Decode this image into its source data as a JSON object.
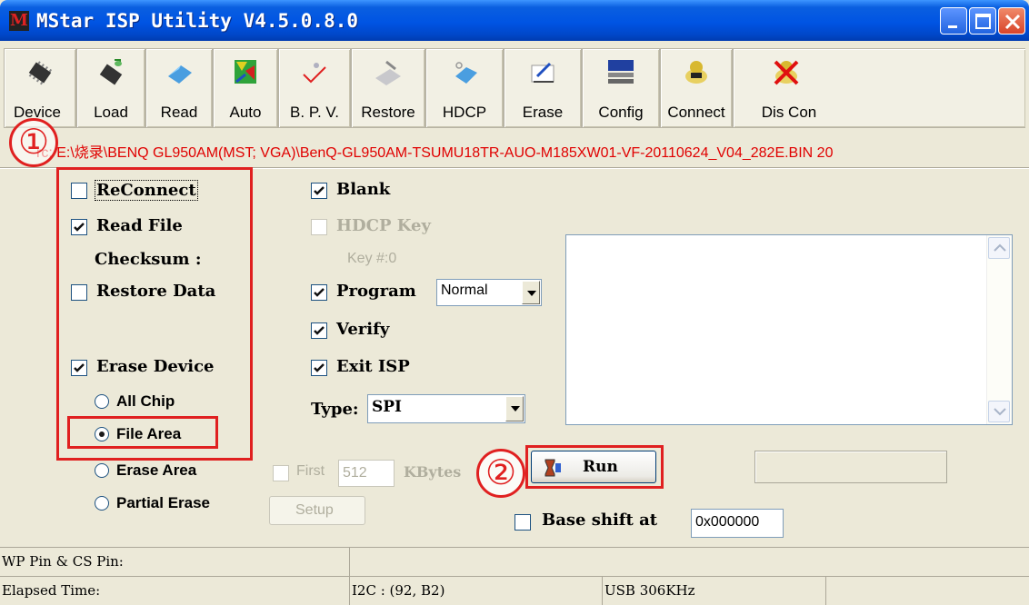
{
  "window": {
    "title": "MStar ISP Utility V4.5.0.8.0",
    "controls": [
      "minimize",
      "maximize",
      "close"
    ]
  },
  "toolbar": [
    {
      "label": "Device",
      "icon": "chip-icon"
    },
    {
      "label": "Load",
      "icon": "load-icon"
    },
    {
      "label": "Read",
      "icon": "read-icon"
    },
    {
      "label": "Auto",
      "icon": "auto-icon"
    },
    {
      "label": "B. P. V.",
      "icon": "bpv-icon"
    },
    {
      "label": "Restore",
      "icon": "restore-icon"
    },
    {
      "label": "HDCP",
      "icon": "hdcp-icon"
    },
    {
      "label": "Erase",
      "icon": "erase-icon"
    },
    {
      "label": "Config",
      "icon": "config-icon"
    },
    {
      "label": "Connect",
      "icon": "connect-icon"
    },
    {
      "label": "Dis Con",
      "icon": "disconnect-icon"
    }
  ],
  "file_path": "rc: E:\\烧录\\BENQ GL950AM(MST;  VGA)\\BenQ-GL950AM-TSUMU18TR-AUO-M185XW01-VF-20110624_V04_282E.BIN  20",
  "markers": {
    "one": "①",
    "two": "②"
  },
  "left_options": {
    "reconnect": {
      "label": "ReConnect",
      "checked": false
    },
    "read_file": {
      "label": "Read File",
      "checked": true
    },
    "checksum_label": "Checksum :",
    "restore_data": {
      "label": "Restore Data",
      "checked": false
    },
    "erase_device": {
      "label": "Erase Device",
      "checked": true
    },
    "erase_modes": [
      {
        "label": "All Chip",
        "selected": false
      },
      {
        "label": "File Area",
        "selected": true
      },
      {
        "label": "Erase Area",
        "selected": false
      },
      {
        "label": "Partial Erase",
        "selected": false
      }
    ]
  },
  "mid_options": {
    "blank": {
      "label": "Blank",
      "checked": true
    },
    "hdcp_key": {
      "label": "HDCP Key",
      "checked": false
    },
    "key_num": "Key #:0",
    "program": {
      "label": "Program",
      "checked": true,
      "mode": "Normal"
    },
    "verify": {
      "label": "Verify",
      "checked": true
    },
    "exit_isp": {
      "label": "Exit ISP",
      "checked": true
    },
    "type_label": "Type:",
    "type_value": "SPI"
  },
  "first": {
    "label": "First",
    "value": "512",
    "unit": "KBytes"
  },
  "setup_label": "Setup",
  "run_label": "Run",
  "base_shift": {
    "label": "Base shift at",
    "value": "0x000000",
    "checked": false
  },
  "status": {
    "wp_cs": "WP Pin & CS Pin:",
    "elapsed": "Elapsed Time:",
    "i2c": "I2C :  (92, B2)",
    "usb": "USB  306KHz"
  }
}
